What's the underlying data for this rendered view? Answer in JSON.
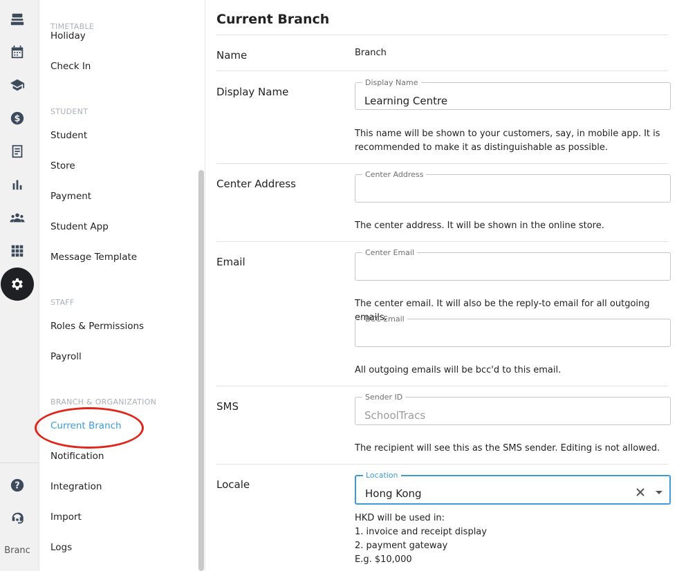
{
  "rail": {
    "branch_label": "Branc"
  },
  "subnav": {
    "sections": {
      "timetable": "TIMETABLE",
      "student": "STUDENT",
      "staff": "STAFF",
      "branch": "BRANCH & ORGANIZATION"
    },
    "items": {
      "holiday": "Holiday",
      "check_in": "Check In",
      "student": "Student",
      "store": "Store",
      "payment": "Payment",
      "student_app": "Student App",
      "message_template": "Message Template",
      "roles": "Roles & Permissions",
      "payroll": "Payroll",
      "current_branch": "Current Branch",
      "notification": "Notification",
      "integration": "Integration",
      "import": "Import",
      "logs": "Logs"
    }
  },
  "main": {
    "title": "Current Branch",
    "name": {
      "label": "Name",
      "value": "Branch"
    },
    "display_name": {
      "label": "Display Name",
      "field_label": "Display Name",
      "value": "Learning Centre",
      "help": "This name will be shown to your customers, say, in mobile app. It is recommended to make it as distinguishable as possible."
    },
    "address": {
      "label": "Center Address",
      "field_label": "Center Address",
      "value": "",
      "help": "The center address. It will be shown in the online store."
    },
    "email": {
      "label": "Email",
      "field_label": "Center Email",
      "value": "",
      "help": "The center email. It will also be the reply-to email for all outgoing emails.",
      "bcc_label": "BCC Email",
      "bcc_value": "",
      "bcc_help": "All outgoing emails will be bcc'd to this email."
    },
    "sms": {
      "label": "SMS",
      "field_label": "Sender ID",
      "value": "SchoolTracs",
      "help": "The recipient will see this as the SMS sender. Editing is not allowed."
    },
    "locale": {
      "label": "Locale",
      "field_label": "Location",
      "value": "Hong Kong",
      "help_lines": [
        "HKD will be used in:",
        "1. invoice and receipt display",
        "2. payment gateway",
        "E.g. $10,000"
      ]
    }
  },
  "colors": {
    "accent": "#3b9bd9",
    "highlight_circle": "#e0261b",
    "rail_active": "#1e2023"
  }
}
